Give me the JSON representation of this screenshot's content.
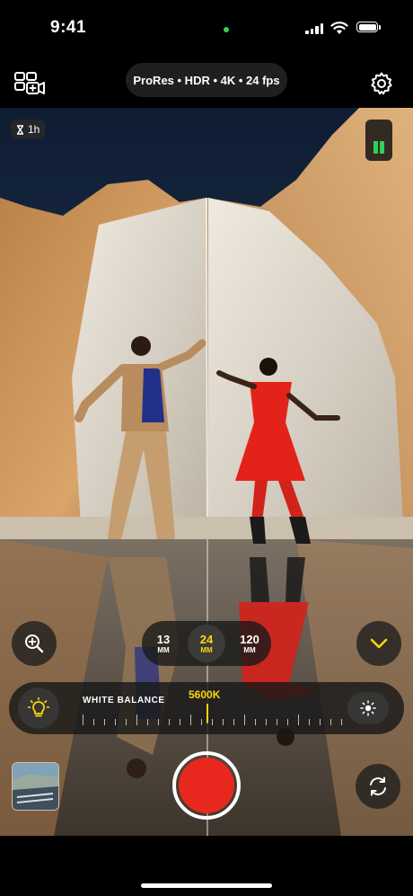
{
  "status_bar": {
    "time": "9:41"
  },
  "top_bar": {
    "format_label": "ProRes • HDR • 4K • 24 fps",
    "left_icon": "camera-switch-mode-icon",
    "right_icon": "gear-icon"
  },
  "viewfinder": {
    "timer_label": "1h",
    "timer_icon": "hourglass-icon",
    "audio_meter_level": 0.6
  },
  "lens": {
    "options": [
      {
        "num": "13",
        "unit": "MM",
        "active": false
      },
      {
        "num": "24",
        "unit": "MM",
        "active": true
      },
      {
        "num": "120",
        "unit": "MM",
        "active": false
      }
    ]
  },
  "white_balance": {
    "label": "WHITE BALANCE",
    "value": "5600K",
    "left_icon": "lightbulb-icon",
    "right_icon": "sun-icon"
  },
  "controls": {
    "zoom_icon": "zoom-in-icon",
    "expand_icon": "chevron-down-icon",
    "flip_icon": "camera-flip-icon"
  },
  "colors": {
    "accent": "#ffd60a",
    "record": "#e8281e",
    "status_green": "#30d158"
  }
}
